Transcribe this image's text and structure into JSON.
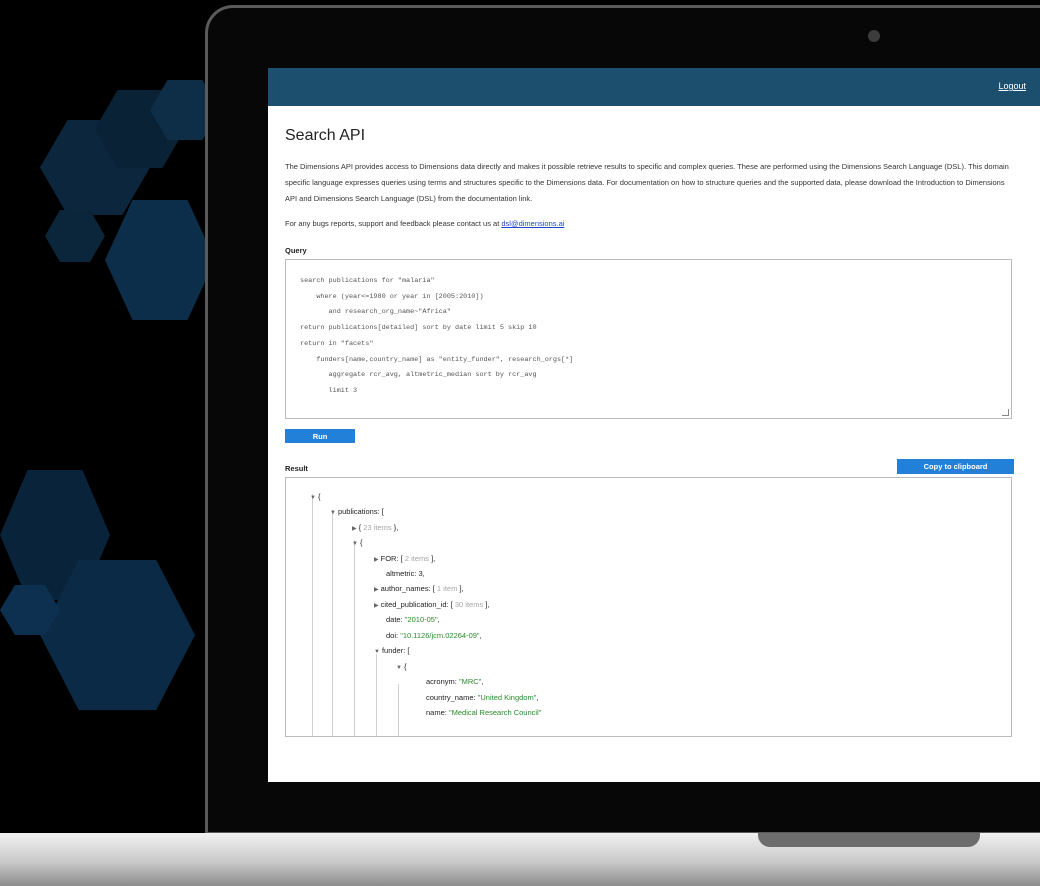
{
  "header": {
    "logout_label": "Logout"
  },
  "page": {
    "title": "Search API",
    "intro": "The Dimensions API provides access to Dimensions data directly and makes it possible retrieve results to specific and complex queries. These are performed using the Dimensions Search Language (DSL). This domain specific language expresses queries using terms and structures specific to the Dimensions data. For documentation on how to structure queries and the supported data, please download the Introduction to Dimensions API and Dimensions Search Language (DSL) from the documentation link.",
    "contact_prefix": "For any bugs reports, support and feedback please contact us at ",
    "contact_email": "dsl@dimensions.ai"
  },
  "query": {
    "label": "Query",
    "lines": [
      "search publications for \"malaria\"",
      "    where (year<=1980 or year in [2005:2010])",
      "       and research_org_name~\"Africa\"",
      "return publications[detailed] sort by date limit 5 skip 10",
      "return in \"facets\"",
      "    funders[name,country_name] as \"entity_funder\", research_orgs[*]",
      "       aggregate rcr_avg, altmetric_median sort by rcr_avg",
      "       limit 3"
    ]
  },
  "run_label": "Run",
  "result": {
    "label": "Result",
    "copy_label": "Copy to clipboard",
    "lines": {
      "root_open": "{",
      "publications_key": "publications: [",
      "collapsed_open": "{",
      "collapsed_count": "23 items",
      "collapsed_close": "},",
      "obj_open": "{",
      "for_key": "FOR: [",
      "for_count": "2 items",
      "for_close": "],",
      "altmetric": "altmetric: 3,",
      "author_key": "author_names: [",
      "author_count": "1 item",
      "author_close": "],",
      "cited_key": "cited_publication_id: [",
      "cited_count": "30 items",
      "cited_close": "],",
      "date_key": "date: ",
      "date_val": "\"2010-05\"",
      "date_end": ",",
      "doi_key": "doi: ",
      "doi_val": "\"10.1126/jcm.02264-09\"",
      "doi_end": ",",
      "funder_key": "funder: [",
      "funder_obj_open": "{",
      "acronym_key": "acronym: ",
      "acronym_val": "\"MRC\"",
      "acronym_end": ",",
      "country_key": "country_name: ",
      "country_val": "\"United Kingdom\"",
      "country_end": ",",
      "name_key": "name: ",
      "name_val": "\"Medical Research Council\""
    }
  }
}
